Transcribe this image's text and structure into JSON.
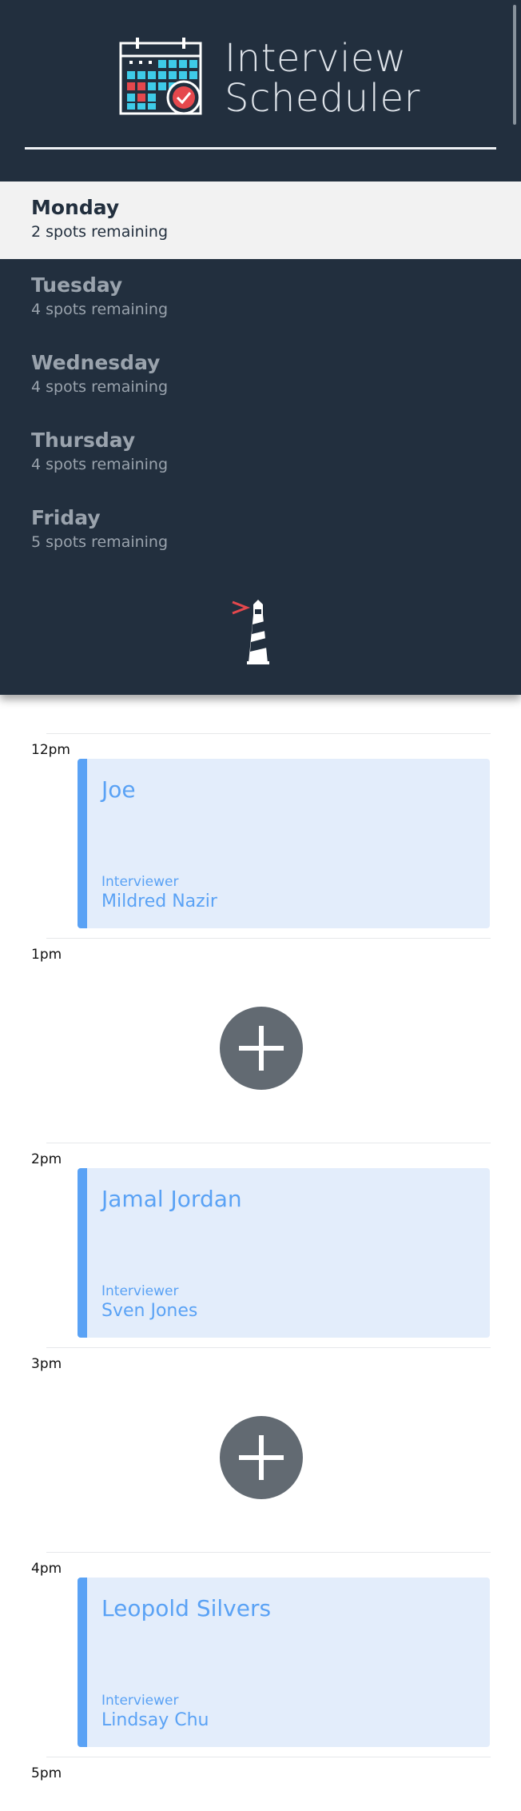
{
  "app": {
    "title_line1": "Interview",
    "title_line2": "Scheduler",
    "logo_icon": "calendar-check-icon",
    "footer_icon": "lighthouse-icon"
  },
  "days": [
    {
      "name": "Monday",
      "spots": "2 spots remaining",
      "selected": true
    },
    {
      "name": "Tuesday",
      "spots": "4 spots remaining",
      "selected": false
    },
    {
      "name": "Wednesday",
      "spots": "4 spots remaining",
      "selected": false
    },
    {
      "name": "Thursday",
      "spots": "4 spots remaining",
      "selected": false
    },
    {
      "name": "Friday",
      "spots": "5 spots remaining",
      "selected": false
    }
  ],
  "schedule": [
    {
      "time": "12pm",
      "type": "appointment",
      "student": "Joe",
      "interviewer_label": "Interviewer",
      "interviewer": "Mildred Nazir"
    },
    {
      "time": "1pm",
      "type": "empty"
    },
    {
      "time": "2pm",
      "type": "appointment",
      "student": "Jamal Jordan",
      "interviewer_label": "Interviewer",
      "interviewer": "Sven Jones"
    },
    {
      "time": "3pm",
      "type": "empty"
    },
    {
      "time": "4pm",
      "type": "appointment",
      "student": "Leopold Silvers",
      "interviewer_label": "Interviewer",
      "interviewer": "Lindsay Chu"
    },
    {
      "time": "5pm",
      "type": "end"
    }
  ],
  "colors": {
    "sidebar_bg": "#222f3e",
    "accent_blue": "#5aa2f5",
    "appointment_bg": "#e3edfb",
    "add_button": "#626a72",
    "logo_red": "#e5484d"
  }
}
